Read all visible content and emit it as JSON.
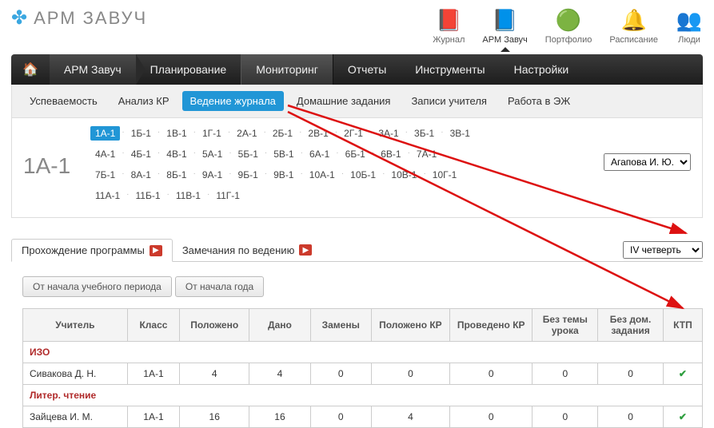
{
  "logo_text": "АРМ ЗАВУЧ",
  "top_icons": [
    {
      "label": "Журнал",
      "glyph": "📕"
    },
    {
      "label": "АРМ Завуч",
      "glyph": "📘"
    },
    {
      "label": "Портфолио",
      "glyph": "🟢"
    },
    {
      "label": "Расписание",
      "glyph": "🔔"
    },
    {
      "label": "Люди",
      "glyph": "👥"
    }
  ],
  "main_nav": {
    "home": "🏠",
    "breadcrumb": "АРМ Завуч",
    "items": [
      "Планирование",
      "Мониторинг",
      "Отчеты",
      "Инструменты",
      "Настройки"
    ],
    "active": "Мониторинг"
  },
  "sub_nav": {
    "items": [
      "Успеваемость",
      "Анализ КР",
      "Ведение журнала",
      "Домашние задания",
      "Записи учителя",
      "Работа в ЭЖ"
    ],
    "active": "Ведение журнала"
  },
  "class_panel": {
    "current": "1А-1",
    "teacher": "Агапова И. Ю.",
    "classes": [
      [
        "1А-1",
        "1Б-1",
        "1В-1",
        "1Г-1",
        "2А-1",
        "2Б-1",
        "2В-1",
        "2Г-1",
        "3А-1",
        "3Б-1",
        "3В-1"
      ],
      [
        "4А-1",
        "4Б-1",
        "4В-1",
        "5А-1",
        "5Б-1",
        "5В-1",
        "6А-1",
        "6Б-1",
        "6В-1",
        "7А-1"
      ],
      [
        "7Б-1",
        "8А-1",
        "8Б-1",
        "9А-1",
        "9Б-1",
        "9В-1",
        "10А-1",
        "10Б-1",
        "10В-1",
        "10Г-1"
      ],
      [
        "11А-1",
        "11Б-1",
        "11В-1",
        "11Г-1"
      ]
    ]
  },
  "tabs": {
    "items": [
      "Прохождение программы",
      "Замечания по ведению"
    ],
    "active": "Прохождение программы",
    "quarter": "IV четверть"
  },
  "period_buttons": [
    "От начала учебного периода",
    "От начала года"
  ],
  "table": {
    "headers": [
      "Учитель",
      "Класс",
      "Положено",
      "Дано",
      "Замены",
      "Положено КР",
      "Проведено КР",
      "Без темы урока",
      "Без дом. задания",
      "КТП"
    ],
    "rows": [
      {
        "type": "subject",
        "label": "ИЗО"
      },
      {
        "type": "data",
        "cells": [
          "Сивакова Д. Н.",
          "1А-1",
          "4",
          "4",
          "0",
          "0",
          "0",
          "0",
          "0",
          "✔"
        ]
      },
      {
        "type": "subject",
        "label": "Литер. чтение"
      },
      {
        "type": "data",
        "cells": [
          "Зайцева И. М.",
          "1А-1",
          "16",
          "16",
          "0",
          "4",
          "0",
          "0",
          "0",
          "✔"
        ]
      }
    ]
  }
}
